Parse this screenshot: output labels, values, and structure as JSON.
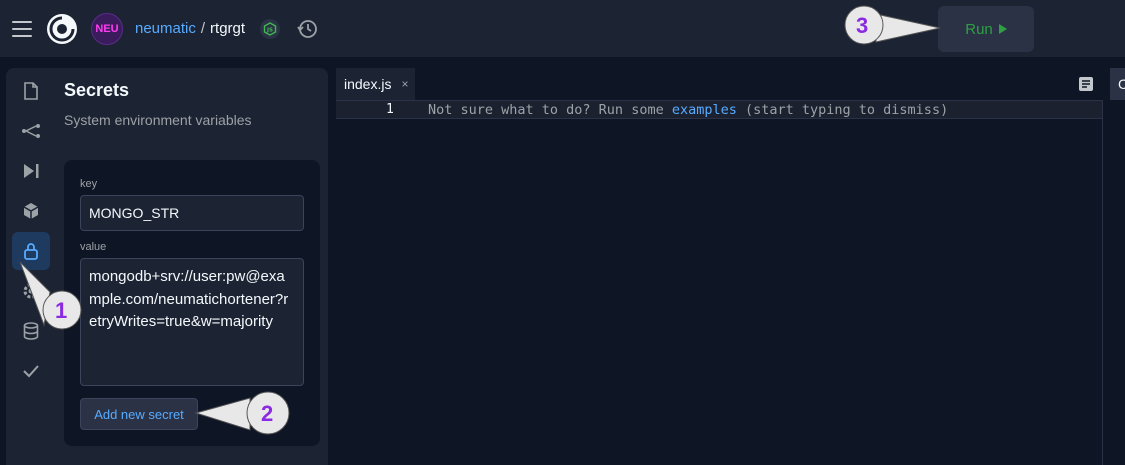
{
  "header": {
    "user": "neumatic",
    "separator": "/",
    "repl_name": "rtgrgt",
    "avatar_text": "NEU",
    "run_label": "Run"
  },
  "rail": {
    "icons": [
      "file-icon",
      "git-branch-icon",
      "debugger-icon",
      "packages-icon",
      "lock-icon",
      "gear-icon",
      "database-icon",
      "check-icon"
    ],
    "active": "lock-icon"
  },
  "secrets": {
    "title": "Secrets",
    "subtitle": "System environment variables",
    "key_label": "key",
    "key_value": "MONGO_STR",
    "value_label": "value",
    "value_value": "mongodb+srv://user:pw@example.com/neumatichortener?retryWrites=true&w=majority",
    "add_button": "Add new secret"
  },
  "editor": {
    "tab_name": "index.js",
    "tab_close": "×",
    "line_number": "1",
    "hint_prefix": "Not sure what to do? Run some ",
    "hint_link": "examples",
    "hint_suffix": " (start typing to dismiss)",
    "right_pane_label": "C"
  },
  "callouts": {
    "one": "1",
    "two": "2",
    "three": "3"
  },
  "colors": {
    "accent_blue": "#57abff",
    "run_green": "#2ea043",
    "callout_purple": "#8a2be2",
    "background": "#0e1525",
    "surface": "#1c2333"
  }
}
